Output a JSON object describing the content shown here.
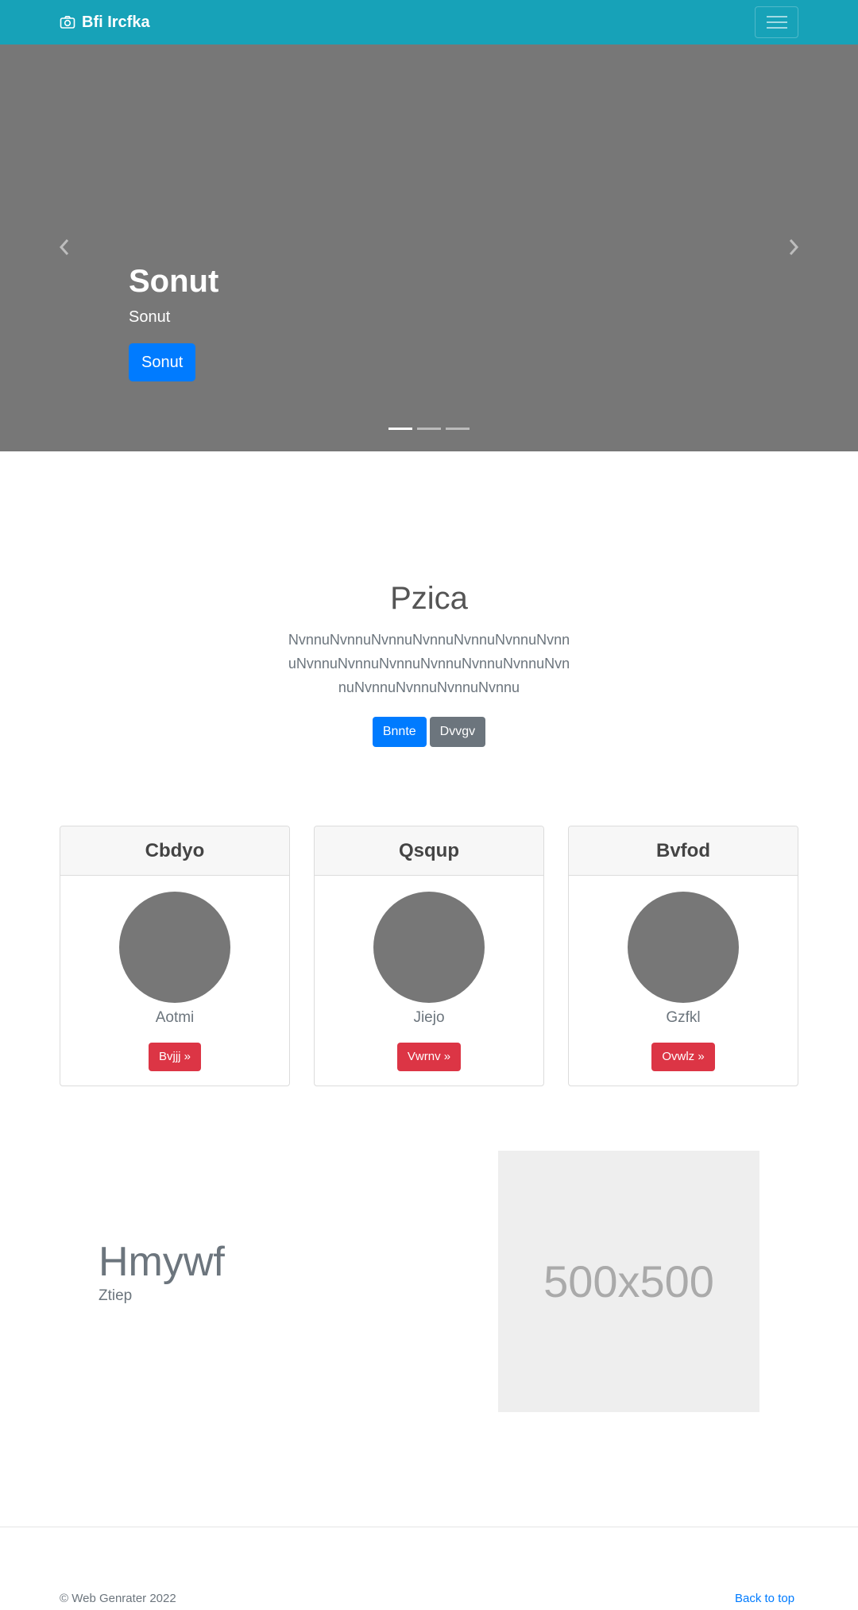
{
  "navbar": {
    "brand": "Bfi Ircfka",
    "brand_icon": "camera-icon",
    "toggler_icon": "hamburger-icon",
    "background": "#17a2b8"
  },
  "carousel": {
    "title": "Sonut",
    "subtitle": "Sonut",
    "button_label": "Sonut",
    "prev_icon": "chevron-left-icon",
    "next_icon": "chevron-right-icon",
    "slide_count": 3,
    "active_slide": 1,
    "background": "#777777"
  },
  "jumbotron": {
    "title": "Pzica",
    "text": "NvnnuNvnnuNvnnuNvnnuNvnnuNvnnuNvnnuNvnnuNvnnuNvnnuNvnnuNvnnuNvnnuNvnnuNvnnuNvnnuNvnnuNvnnu",
    "primary_label": "Bnnte",
    "secondary_label": "Dvvgv"
  },
  "cards": [
    {
      "header": "Cbdyo",
      "name": "Aotmi",
      "button": "Bvjjj »"
    },
    {
      "header": "Qsqup",
      "name": "Jiejo",
      "button": "Vwrnv »"
    },
    {
      "header": "Bvfod",
      "name": "Gzfkl",
      "button": "Ovwlz »"
    }
  ],
  "feature": {
    "title": "Hmywf",
    "subtitle": "Ztiep",
    "placeholder_text": "500x500"
  },
  "footer": {
    "copyright": "© Web Genrater 2022",
    "back_to_top": "Back to top"
  },
  "colors": {
    "primary": "#007bff",
    "secondary": "#6c757d",
    "danger": "#dc3545"
  }
}
